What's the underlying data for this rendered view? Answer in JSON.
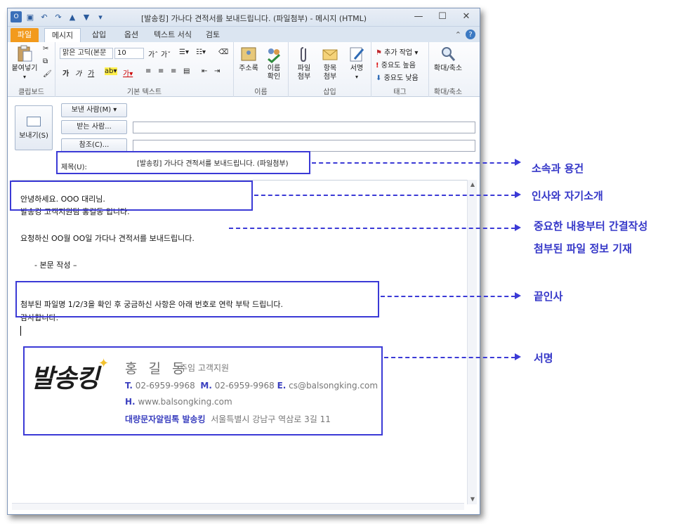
{
  "window": {
    "title": "[발송킹] 가나다 견적서를 보내드립니다. (파일첨부) - 메시지 (HTML)"
  },
  "tabs": [
    "파일",
    "메시지",
    "삽입",
    "옵션",
    "텍스트 서식",
    "검토"
  ],
  "ribbon": {
    "clipboard": {
      "paste": "붙여넣기",
      "label": "클립보드"
    },
    "basic_text": {
      "font": "맑은 고딕(본문",
      "size": "10",
      "label": "기본 텍스트"
    },
    "names": {
      "address_book": "주소록",
      "check_names_1": "이름",
      "check_names_2": "확인",
      "label": "이름"
    },
    "insert": {
      "attach_file_1": "파일",
      "attach_file_2": "첨부",
      "attach_item_1": "항목",
      "attach_item_2": "첨부",
      "signature": "서명",
      "label": "삽입"
    },
    "tags": {
      "follow_up": "추가 작업",
      "high": "중요도 높음",
      "low": "중요도 낮음",
      "label": "태그"
    },
    "zoom": {
      "zoom": "확대/축소",
      "label": "확대/축소"
    }
  },
  "compose": {
    "send": "보내기(S)",
    "from": "보낸 사람(M) ▾",
    "to": "받는 사람...",
    "cc": "참조(C)...",
    "subject_label": "제목(U):",
    "subject_value": "[발송킹] 가나다 견적서를 보내드립니다. (파일첨부)"
  },
  "body": {
    "greeting1": "안녕하세요. OOO 대리님.",
    "greeting2": "발송킹 고객지원팀 홍길동 입니다.",
    "main": "요청하신 OO월  OO일 가다나 견적서를 보내드립니다.",
    "content": "-   본문 작성 –",
    "closing1": "첨부된 파일명 1/2/3을 확인 후 궁금하신 사항은 아래 번호로 연락 부탁 드립니다.",
    "closing2": "감사합니다."
  },
  "signature": {
    "logo": "발송킹",
    "name": "홍 길 동",
    "title": "주임 고객지원",
    "t_label": "T.",
    "tel": "02-6959-9968",
    "m_label": "M.",
    "mobile": "02-6959-9968",
    "e_label": "E.",
    "email": "cs@balsongking.com",
    "h_label": "H.",
    "homepage": "www.balsongking.com",
    "company": "대량문자알림톡 발송킹",
    "address": "서울특별시 강남구 역삼로 3길 11"
  },
  "annotations": {
    "subject": "소속과 용건",
    "greeting": "인사와 자기소개",
    "main1": "중요한 내용부터 간결작성",
    "main2": "첨부된 파일 정보 기재",
    "closing": "끝인사",
    "signature": "서명"
  },
  "colors": {
    "annotation": "#3b3ad6",
    "file_tab": "#f29a1d"
  }
}
